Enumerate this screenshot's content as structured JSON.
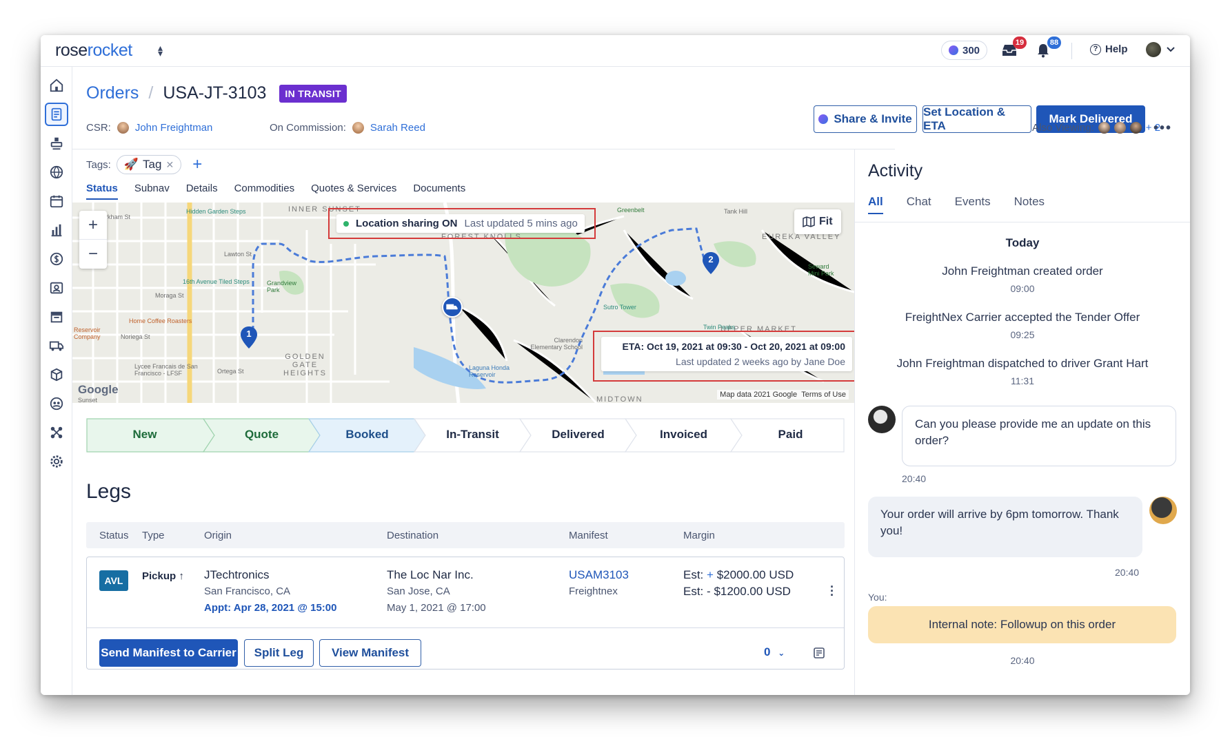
{
  "topbar": {
    "logo_main": "rose",
    "logo_accent": "rocket",
    "credits": "300",
    "notif_badge_a": "19",
    "notif_badge_b": "88",
    "help_label": "Help"
  },
  "header": {
    "breadcrumb_root": "Orders",
    "breadcrumb_sep": "/",
    "order_id": "USA-JT-3103",
    "status": "IN TRANSIT",
    "share_label": "Share & Invite",
    "set_location_label": "Set Location & ETA",
    "mark_delivered_label": "Mark Delivered",
    "csr_label": "CSR:",
    "csr_name": "John Freightman",
    "commission_label": "On Commission:",
    "commission_name": "Sarah Reed",
    "also_viewing_label": "Also Viewing:",
    "also_viewing_more": "+ 2"
  },
  "tags": {
    "label": "Tags:",
    "items": [
      {
        "label": "Tag"
      }
    ]
  },
  "tabs": [
    {
      "label": "Status",
      "active": true
    },
    {
      "label": "Subnav"
    },
    {
      "label": "Details"
    },
    {
      "label": "Commodities"
    },
    {
      "label": "Quotes & Services"
    },
    {
      "label": "Documents"
    }
  ],
  "map": {
    "fit_label": "Fit",
    "location_status": "Location sharing ON",
    "location_updated": "Last updated 5 mins ago",
    "eta": "ETA: Oct 19, 2021 at 09:30 - Oct 20, 2021 at 09:00",
    "eta_updated": "Last updated 2 weeks ago by Jane Doe",
    "attribution": "Map data 2021 Google",
    "terms": "Terms of Use",
    "google": "Google",
    "pins": [
      {
        "label": "1"
      },
      {
        "label": "2"
      }
    ],
    "labels": {
      "inner_sunset": "INNER SUNSET",
      "forest_knolls": "FOREST KNOLLS",
      "eureka_valley": "EUREKA VALLEY",
      "golden_gate_heights": "GOLDEN GATE HEIGHTS",
      "upper_market": "UPPER MARKET",
      "midtown": "MIDTOWN",
      "kirkham": "Kirkham St",
      "hidden_garden": "Hidden Garden Steps",
      "tiled_steps": "16th Avenue Tiled Steps",
      "grandview": "Grandview Park",
      "home_coffee": "Home Coffee Roasters",
      "reservoir_company": "Reservoir Company",
      "lycee": "Lycee Francais de San Francisco - LFSF",
      "sutro_tower": "Sutro Tower",
      "clarendon": "Clarendon Elementary School",
      "laguna_honda": "Laguna Honda Reservoir",
      "twin_peaks": "Twin Peaks",
      "seward": "Seward Mini Park",
      "tank_hill": "Tank Hill",
      "greenbelt": "Greenbelt",
      "noriega": "Noriega St",
      "ortega": "Ortega St",
      "moraga": "Moraga St",
      "lawton": "Lawton St",
      "sunset": "Sunset"
    }
  },
  "stages": [
    {
      "label": "New",
      "state": "done"
    },
    {
      "label": "Quote",
      "state": "done"
    },
    {
      "label": "Booked",
      "state": "current"
    },
    {
      "label": "In-Transit",
      "state": "todo"
    },
    {
      "label": "Delivered",
      "state": "todo"
    },
    {
      "label": "Invoiced",
      "state": "todo"
    },
    {
      "label": "Paid",
      "state": "todo"
    }
  ],
  "legs": {
    "title": "Legs",
    "columns": [
      "Status",
      "Type",
      "Origin",
      "Destination",
      "Manifest",
      "Margin"
    ],
    "row": {
      "status": "AVL",
      "type": "Pickup",
      "origin_name": "JTechtronics",
      "origin_city": "San Francisco, CA",
      "origin_appt": "Appt: Apr 28, 2021 @ 15:00",
      "dest_name": "The Loc Nar Inc.",
      "dest_city": "San Jose, CA",
      "dest_date": "May 1, 2021 @ 17:00",
      "manifest_id": "USAM3103",
      "manifest_carrier": "Freightnex",
      "margin_est_plus_label": "Est:",
      "margin_plus_sign": "+",
      "margin_plus_value": "$2000.00 USD",
      "margin_est_minus_label": "Est:",
      "margin_minus_sign": "-",
      "margin_minus_value": "$1200.00 USD"
    },
    "send_manifest_label": "Send Manifest to Carrier",
    "split_leg_label": "Split Leg",
    "view_manifest_label": "View Manifest",
    "count": "0"
  },
  "activity": {
    "title": "Activity",
    "tabs": [
      {
        "label": "All",
        "active": true
      },
      {
        "label": "Chat"
      },
      {
        "label": "Events"
      },
      {
        "label": "Notes"
      }
    ],
    "today_label": "Today",
    "events": [
      {
        "text": "John Freightman created order",
        "time": "09:00"
      },
      {
        "text": "FreightNex Carrier accepted the Tender Offer",
        "time": "09:25"
      },
      {
        "text": "John Freightman dispatched to driver Grant Hart",
        "time": "11:31"
      }
    ],
    "messages": [
      {
        "text": "Can you please provide me an update on this order?",
        "time": "20:40"
      },
      {
        "text": "Your order will arrive by 6pm tomorrow. Thank you!",
        "time": "20:40"
      }
    ],
    "you_label": "You:",
    "internal_note": "Internal note: Followup on this order",
    "internal_time": "20:40"
  },
  "colors": {
    "accent": "#1f56b8",
    "status_purple": "#6b2fcf",
    "stage_done": "#e8f6ec",
    "stage_current": "#e4f1fb",
    "highlight": "#d43a3a",
    "note_bg": "#fbe3b3"
  }
}
